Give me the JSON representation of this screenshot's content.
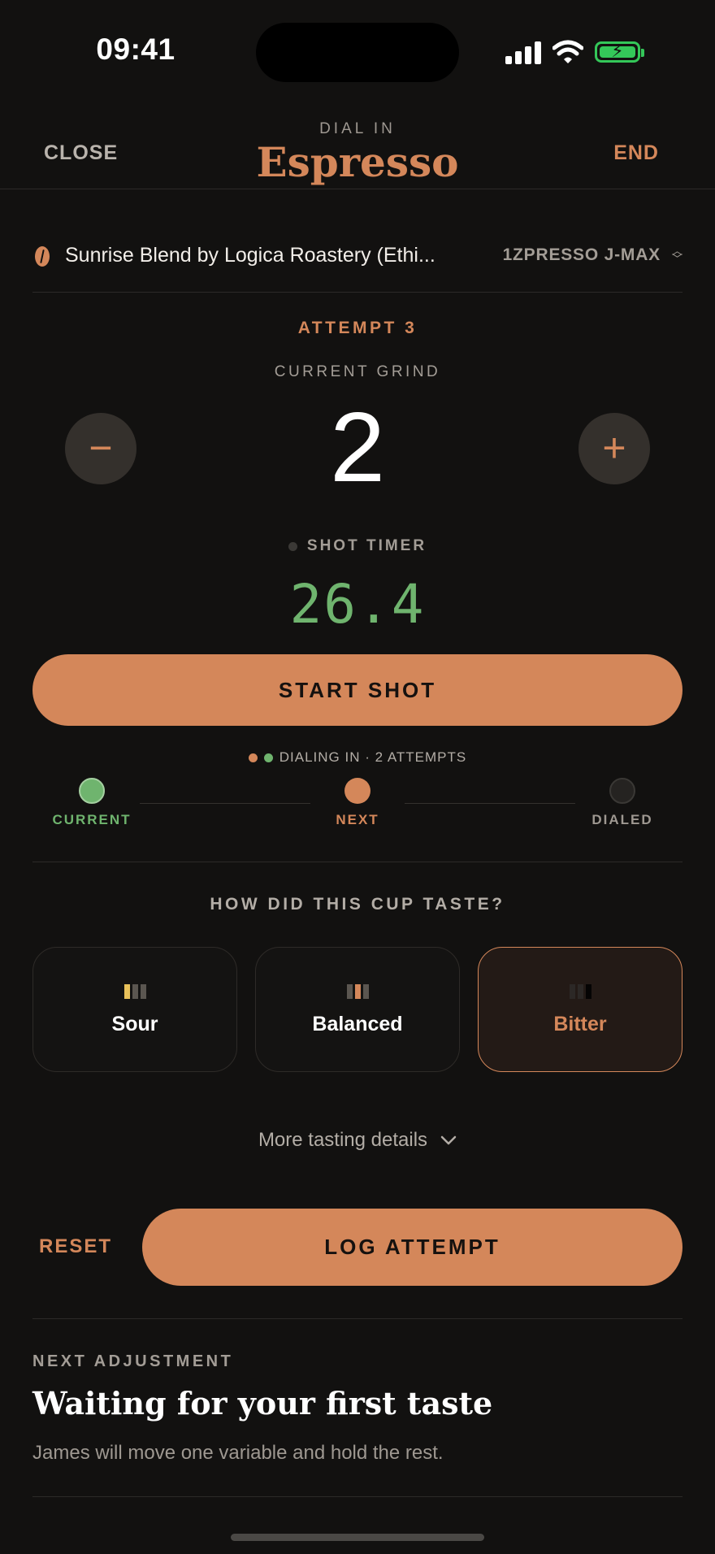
{
  "status_bar": {
    "time": "09:41"
  },
  "header": {
    "close_label": "CLOSE",
    "kicker": "DIAL IN",
    "title": "Espresso",
    "end_label": "END"
  },
  "bean": {
    "name": "Sunrise Blend by Logica Roastery (Ethi...",
    "icon": "coffee-bean-icon",
    "grinder": "1ZPRESSO J-MAX"
  },
  "attempt": {
    "label": "ATTEMPT 3"
  },
  "grind": {
    "label": "CURRENT GRIND",
    "value": "2",
    "decrement": "−",
    "increment": "+"
  },
  "timer": {
    "label": "SHOT TIMER",
    "value": "26.4"
  },
  "start_shot": {
    "label": "START SHOT"
  },
  "progress": {
    "summary": "DIALING IN · 2 ATTEMPTS",
    "steps": [
      {
        "label": "CURRENT",
        "color": "#6fb46e"
      },
      {
        "label": "NEXT",
        "color": "#d4875a"
      },
      {
        "label": "DIALED",
        "color": "#9e9891"
      }
    ]
  },
  "taste": {
    "question": "HOW DID THIS CUP TASTE?",
    "options": [
      {
        "label": "Sour",
        "selected": false
      },
      {
        "label": "Balanced",
        "selected": false
      },
      {
        "label": "Bitter",
        "selected": true
      }
    ],
    "more_label": "More tasting details"
  },
  "actions": {
    "reset_label": "RESET",
    "log_label": "LOG ATTEMPT"
  },
  "next_adjustment": {
    "kicker": "NEXT ADJUSTMENT",
    "title": "Waiting for your first taste",
    "subtitle": "James will move one variable and hold the rest."
  },
  "colors": {
    "accent": "#d4875a",
    "success": "#6fb46e",
    "background": "#121110"
  }
}
